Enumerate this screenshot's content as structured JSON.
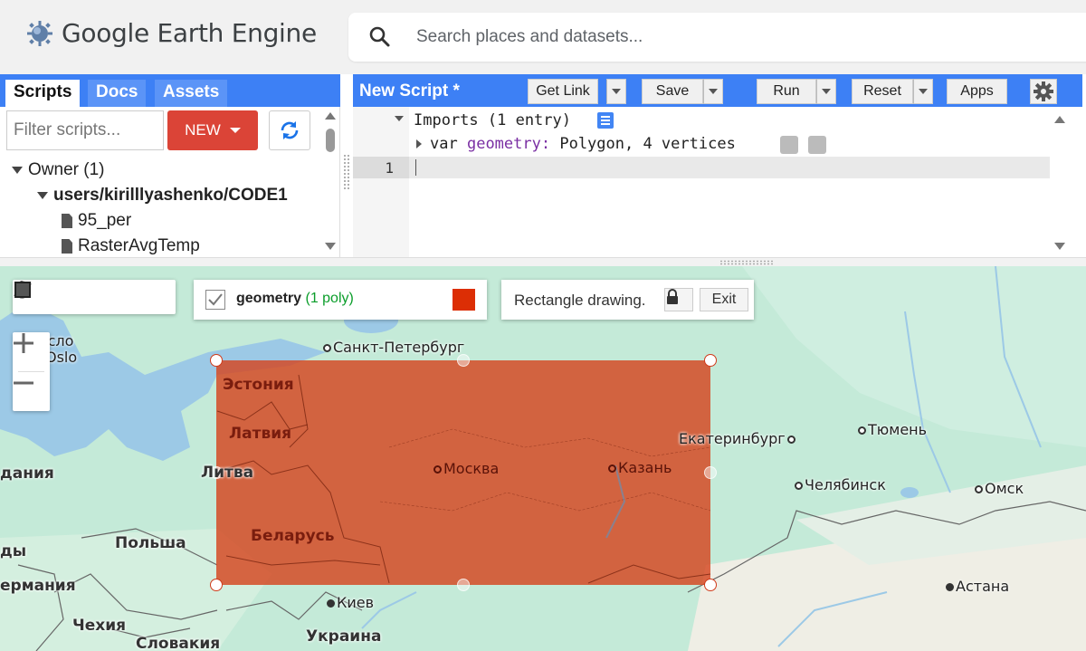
{
  "header": {
    "app_title": "Google Earth Engine",
    "search_placeholder": "Search places and datasets..."
  },
  "left_panel": {
    "tabs": [
      {
        "label": "Scripts",
        "active": true
      },
      {
        "label": "Docs",
        "active": false
      },
      {
        "label": "Assets",
        "active": false
      }
    ],
    "filter_placeholder": "Filter scripts...",
    "new_button": "NEW",
    "tree": {
      "owner": "Owner (1)",
      "repo": "users/kirilllyashenko/CODE1",
      "files": [
        "95_per",
        "RasterAvgTemp"
      ]
    }
  },
  "editor": {
    "script_title": "New Script *",
    "buttons": {
      "get_link": "Get Link",
      "save": "Save",
      "run": "Run",
      "reset": "Reset",
      "apps": "Apps"
    },
    "imports_line": "Imports (1 entry)",
    "var_keyword": "var",
    "var_name": "geometry:",
    "var_value": "Polygon, 4 vertices",
    "line_number": "1"
  },
  "map": {
    "geometry_layer": {
      "name": "geometry",
      "count": "(1 poly)",
      "color": "#dc2e05",
      "checked": true
    },
    "drawing_status": "Rectangle drawing.",
    "exit_button": "Exit",
    "zoom_in": "+",
    "zoom_out": "−",
    "labels": {
      "estonia": "Эстония",
      "latvia": "Латвия",
      "lithuania": "Литва",
      "belarus": "Беларусь",
      "poland": "Польша",
      "ukraine": "Украина",
      "czechia": "Чехия",
      "slovakia": "Словакия",
      "denmark": "дания",
      "germany": "ермания",
      "netherlands": "ды",
      "oslo_ru": "Осло",
      "oslo": "Oslo",
      "st_petersburg": "Санкт-Петербург",
      "moscow": "Москва",
      "kazan": "Казань",
      "yekaterinburg": "Екатеринбург",
      "tyumen": "Тюмень",
      "chelyabinsk": "Челябинск",
      "omsk": "Омск",
      "kyiv": "Киев",
      "astana": "Астана"
    }
  }
}
